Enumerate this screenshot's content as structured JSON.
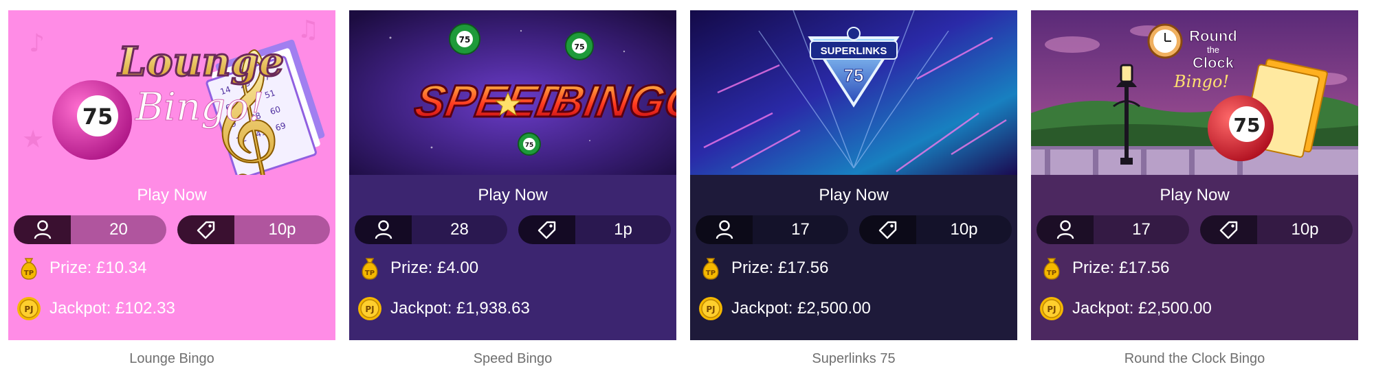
{
  "games": [
    {
      "art_id": "lounge",
      "art_text": [
        "Lounge",
        "Bingo!"
      ],
      "ball_number": "75",
      "play_label": "Play Now",
      "players": "20",
      "ticket_price": "10p",
      "prize": "Prize: £10.34",
      "jackpot": "Jackpot: £102.33",
      "prize_badge": "TP",
      "jackpot_badge": "PJ",
      "name": "Lounge Bingo",
      "panel_color": "#ff8ce6"
    },
    {
      "art_id": "speed",
      "art_text": [
        "SPEED",
        "BINGO"
      ],
      "ball_number": "75",
      "play_label": "Play Now",
      "players": "28",
      "ticket_price": "1p",
      "prize": "Prize: £4.00",
      "jackpot": "Jackpot: £1,938.63",
      "prize_badge": "TP",
      "jackpot_badge": "PJ",
      "name": "Speed Bingo",
      "panel_color": "#3c2570"
    },
    {
      "art_id": "superlinks",
      "art_text": [
        "SUPERLINKS",
        "75"
      ],
      "ball_number": "75",
      "play_label": "Play Now",
      "players": "17",
      "ticket_price": "10p",
      "prize": "Prize: £17.56",
      "jackpot": "Jackpot: £2,500.00",
      "prize_badge": "TP",
      "jackpot_badge": "PJ",
      "name": "Superlinks 75",
      "panel_color": "#1e1a3a"
    },
    {
      "art_id": "rtc",
      "art_text": [
        "Round",
        "the",
        "Clock",
        "Bingo!"
      ],
      "ball_number": "75",
      "play_label": "Play Now",
      "players": "17",
      "ticket_price": "10p",
      "prize": "Prize: £17.56",
      "jackpot": "Jackpot: £2,500.00",
      "prize_badge": "TP",
      "jackpot_badge": "PJ",
      "name": "Round the Clock Bingo",
      "panel_color": "#4c2860"
    }
  ],
  "icons": {
    "players": "person-icon",
    "price": "price-tag-icon",
    "prize": "money-bag-icon",
    "jackpot": "gold-coin-icon"
  },
  "colors": {
    "caption_text": "#6f6f6f",
    "coin_gold": "#f5b800"
  }
}
